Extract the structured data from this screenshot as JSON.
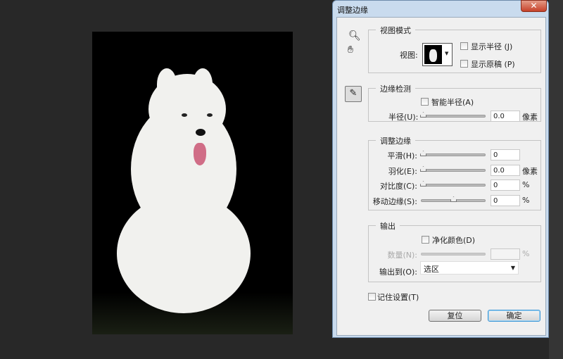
{
  "dialog": {
    "title": "调整边缘",
    "close": "✕"
  },
  "tools": {
    "zoom": "zoom-icon",
    "hand": "hand-icon",
    "brush": "refine-radius-brush-icon"
  },
  "view_mode": {
    "group_label": "视图模式",
    "view_label": "视图:",
    "show_radius": "显示半径 (J)",
    "show_original": "显示原稿 (P)"
  },
  "edge_detection": {
    "group_label": "边缘检测",
    "smart_radius": "智能半径(A)",
    "radius_label": "半径(U):",
    "radius_value": "0.0",
    "radius_unit": "像素",
    "radius_slider": 0
  },
  "adjust_edge": {
    "group_label": "调整边缘",
    "rows": [
      {
        "label": "平滑(H):",
        "value": "0",
        "unit": "",
        "slider": 0
      },
      {
        "label": "羽化(E):",
        "value": "0.0",
        "unit": "像素",
        "slider": 0
      },
      {
        "label": "对比度(C):",
        "value": "0",
        "unit": "%",
        "slider": 0
      },
      {
        "label": "移动边缘(S):",
        "value": "0",
        "unit": "%",
        "slider": 0.5
      }
    ]
  },
  "output": {
    "group_label": "输出",
    "decontaminate": "净化颜色(D)",
    "amount_label": "数量(N):",
    "amount_unit": "%",
    "output_to_label": "输出到(O):",
    "output_to_value": "选区"
  },
  "remember": "记住设置(T)",
  "buttons": {
    "reset": "复位",
    "ok": "确定"
  }
}
